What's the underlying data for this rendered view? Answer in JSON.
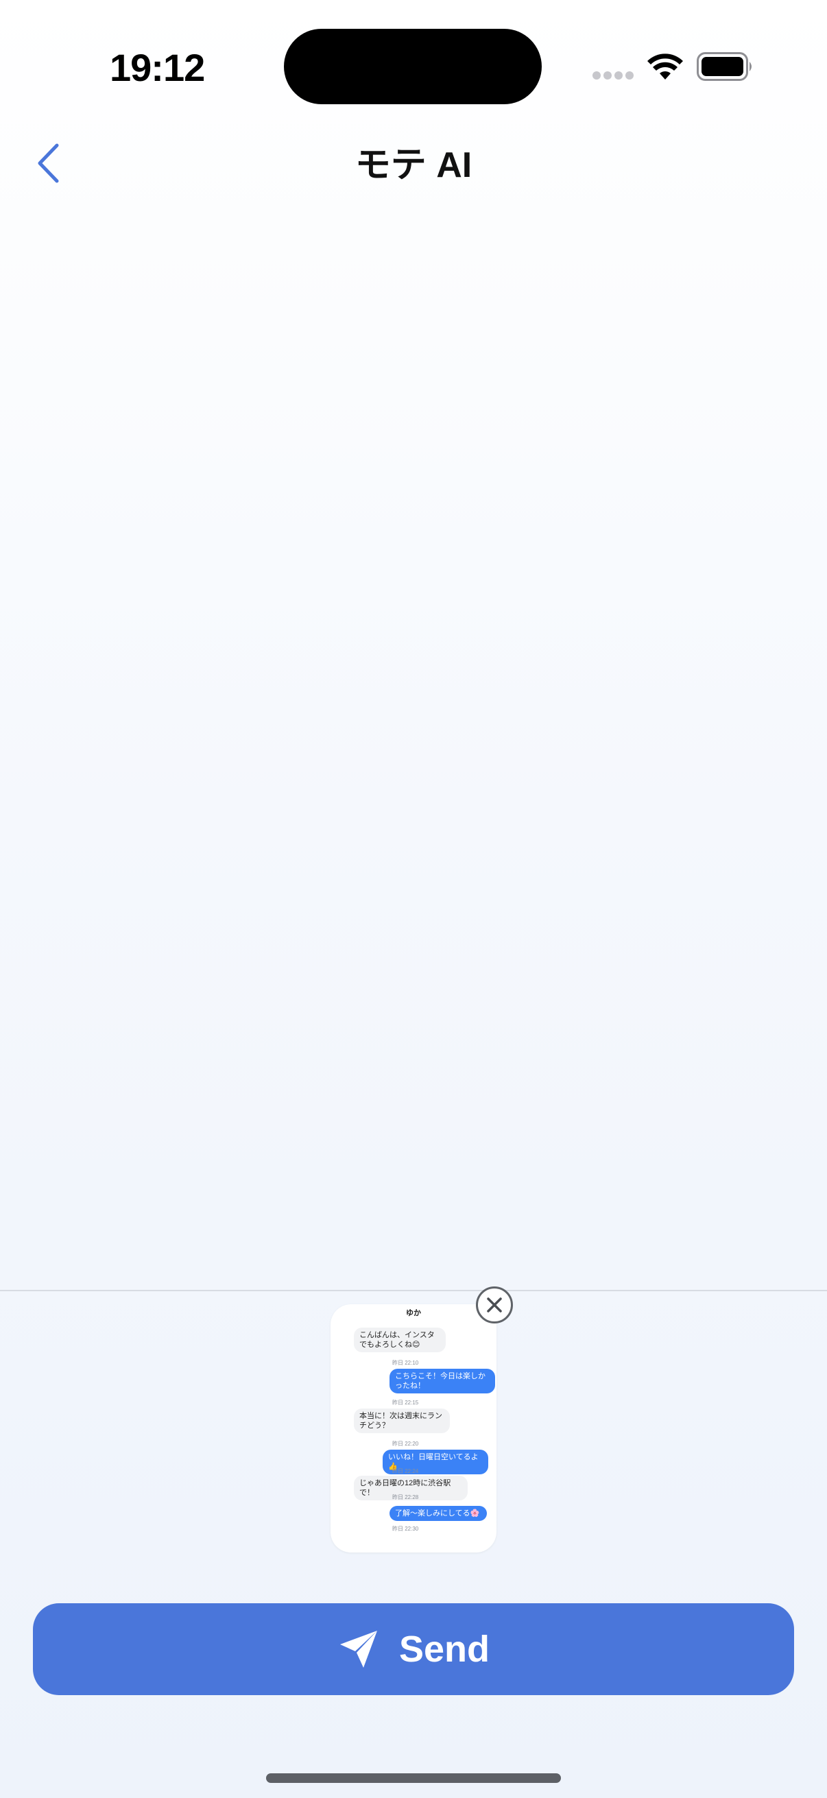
{
  "status_bar": {
    "time": "19:12"
  },
  "nav": {
    "title": "モテ AI"
  },
  "attachment": {
    "contact_name": "ゆか",
    "messages": [
      {
        "side": "in",
        "text": "こんばんは、インスタでもよろしくね😊",
        "time": "昨日 22:10"
      },
      {
        "side": "out",
        "text": "こちらこそ！今日は楽しかったね！",
        "time": "昨日 22:15"
      },
      {
        "side": "in",
        "text": "本当に！次は週末にランチどう？",
        "time": "昨日 22:20"
      },
      {
        "side": "out",
        "text": "いいね！日曜日空いてるよ👍",
        "time": "昨日 22:24"
      },
      {
        "side": "in",
        "text": "じゃあ日曜の12時に渋谷駅で！",
        "time": "昨日 22:28"
      },
      {
        "side": "out",
        "text": "了解〜楽しみにしてる🌸",
        "time": "昨日 22:30"
      }
    ]
  },
  "actions": {
    "send_label": "Send"
  },
  "colors": {
    "accent": "#4a76da",
    "bubble_out": "#3b82f6",
    "background": "#f5f8fd"
  }
}
